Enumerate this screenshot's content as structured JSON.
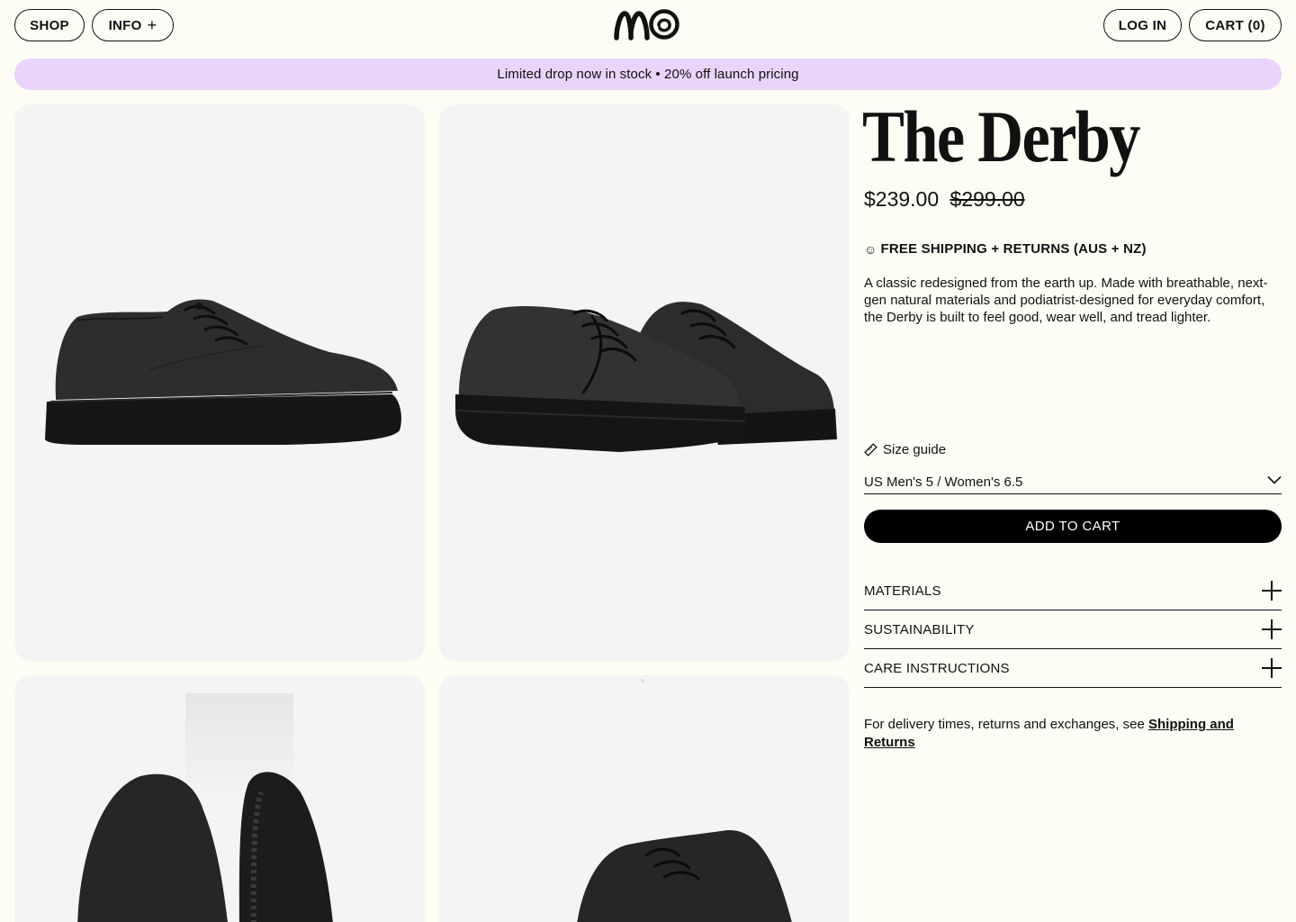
{
  "header": {
    "shop_label": "SHOP",
    "info_label": "INFO",
    "login_label": "LOG IN",
    "cart_label": "CART (0)"
  },
  "promo": {
    "text": "Limited drop now in stock •  20% off launch pricing"
  },
  "gallery": {
    "images": [
      "shoe-side-view",
      "shoe-pair-angled-view",
      "shoe-top-and-sole-view",
      "shoe-back-angled-view"
    ]
  },
  "product": {
    "title": "The Derby",
    "price_current": "$239.00",
    "price_original": "$299.00",
    "shipping_icon": "☺",
    "shipping_text": "FREE SHIPPING + RETURNS (AUS + NZ)",
    "description": "A classic redesigned from the earth up. Made with breathable, next-gen natural materials and podiatrist-designed for everyday comfort, the Derby is built to feel good, wear well, and tread lighter.",
    "size_guide_label": "Size guide",
    "selected_size": "US Men's 5 / Women's 6.5",
    "add_to_cart_label": "ADD TO CART",
    "accordions": [
      {
        "label": "MATERIALS"
      },
      {
        "label": "SUSTAINABILITY"
      },
      {
        "label": "CARE INSTRUCTIONS"
      }
    ],
    "delivery_text": "For delivery times, returns and exchanges, see ",
    "delivery_link": "Shipping and Returns"
  },
  "colors": {
    "background": "#fdfdf5",
    "promo_bg": "#ead4fb",
    "tile_bg": "#f4f4f4",
    "accent": "#000000"
  }
}
